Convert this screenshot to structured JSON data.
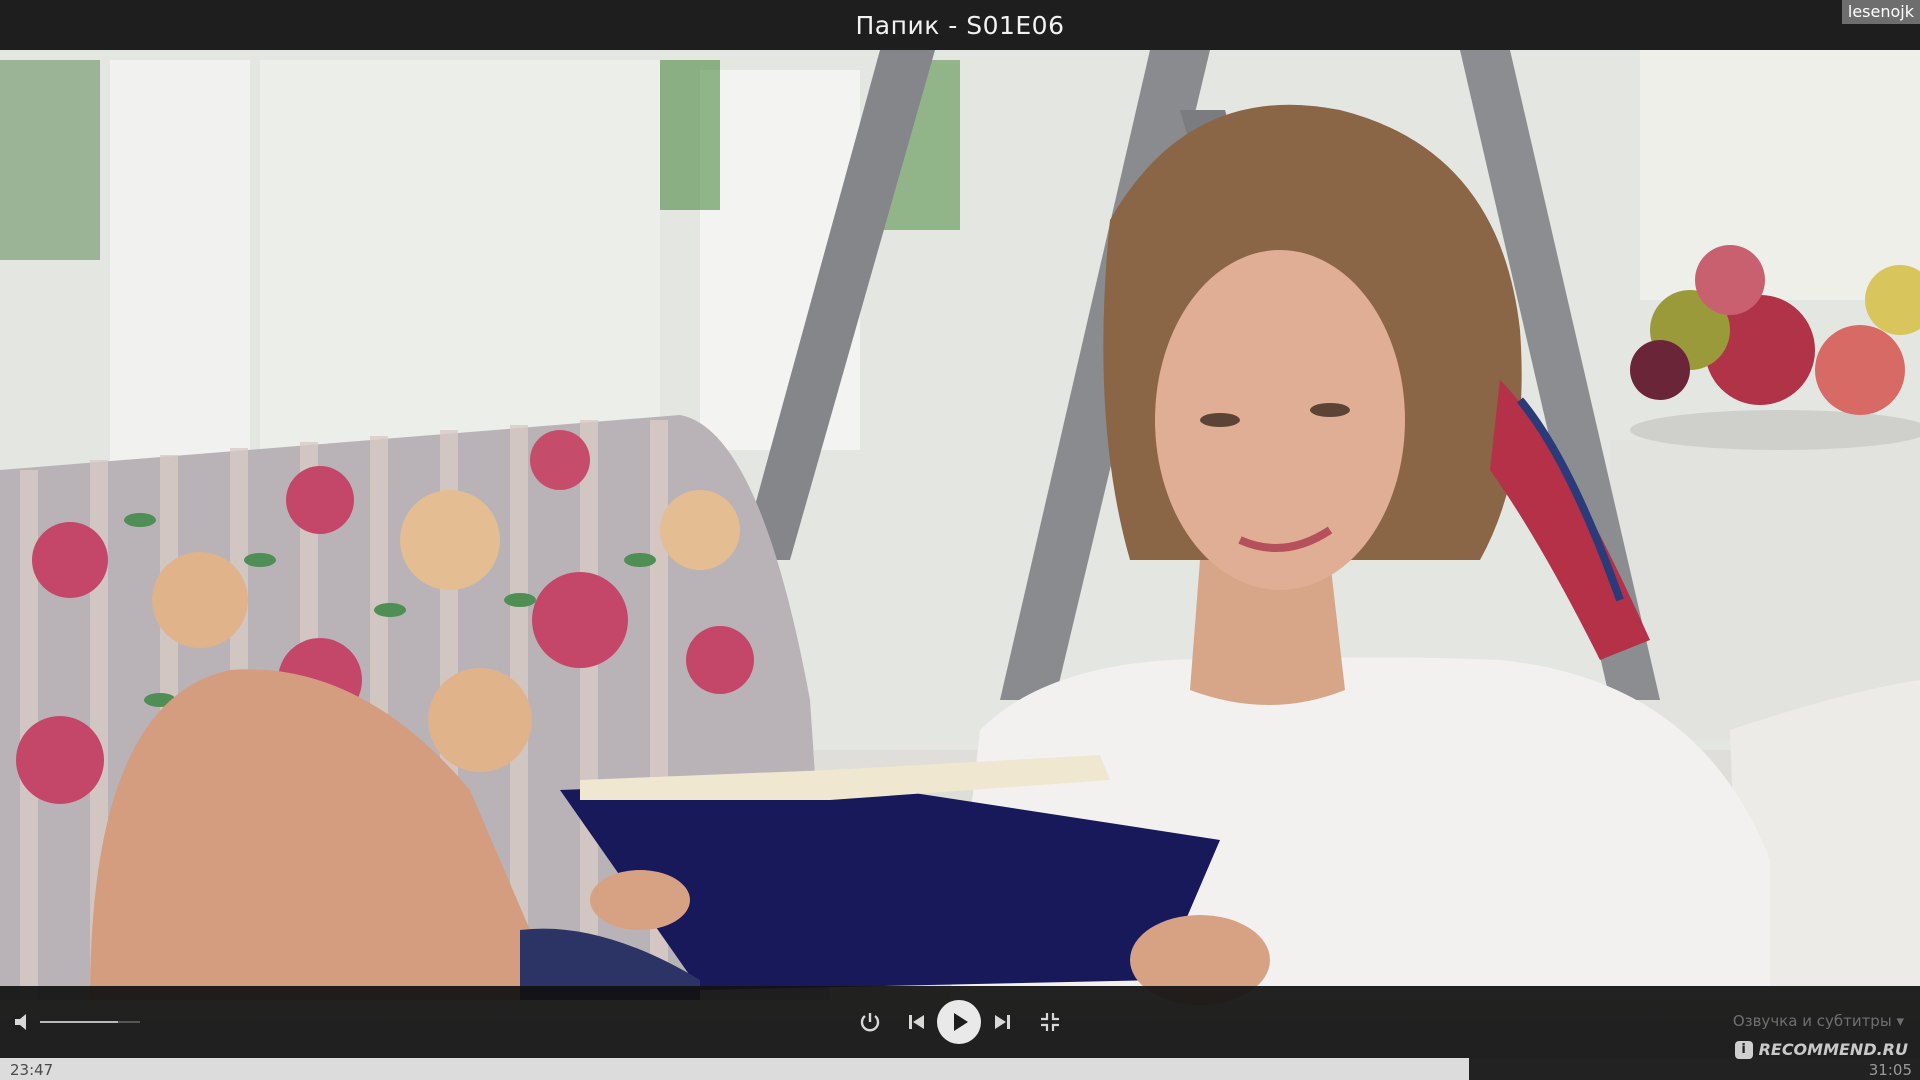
{
  "window": {
    "title": "Папик - S01E06",
    "user": "lesenojk"
  },
  "video": {
    "scene": "video-frame"
  },
  "controls": {
    "volume_level": 0.78,
    "audio_subtitles_label": "Озвучка и субтитры",
    "icons": [
      "volume-icon",
      "power-icon",
      "previous-icon",
      "play-icon",
      "next-icon",
      "exit-fullscreen-icon",
      "chevron-down-icon"
    ]
  },
  "progress": {
    "elapsed": "23:47",
    "total": "31:05",
    "fraction": 0.765
  },
  "watermark": {
    "badge": "i",
    "text": "RECOMMEND.RU"
  },
  "colors": {
    "bar_bg": "#1e1e1e",
    "control_icon": "#d8d8d8",
    "progress_fill": "#dcdcdc"
  }
}
